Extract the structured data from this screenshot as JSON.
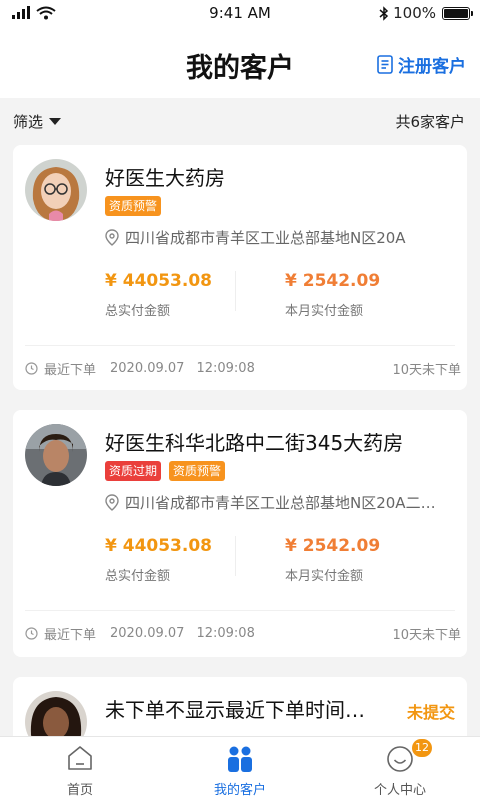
{
  "status_bar": {
    "time": "9:41 AM",
    "battery": "100%"
  },
  "header": {
    "title": "我的客户",
    "register_label": "注册客户"
  },
  "filter": {
    "label": "筛选",
    "count": "共6家客户"
  },
  "customers": [
    {
      "name": "好医生大药房",
      "tags": [
        "资质预警"
      ],
      "address": "四川省成都市青羊区工业总部基地N区20A",
      "total_amount": "¥ 44053.08",
      "total_label": "总实付金额",
      "month_amount": "¥ 2542.09",
      "month_label": "本月实付金额",
      "last_order_label": "最近下单",
      "last_order_date": "2020.09.07",
      "last_order_time": "12:09:08",
      "days": "10天未下单"
    },
    {
      "name": "好医生科华北路中二街345大药房",
      "tags": [
        "资质过期",
        "资质预警"
      ],
      "address": "四川省成都市青羊区工业总部基地N区20A二…",
      "total_amount": "¥ 44053.08",
      "total_label": "总实付金额",
      "month_amount": "¥ 2542.09",
      "month_label": "本月实付金额",
      "last_order_label": "最近下单",
      "last_order_date": "2020.09.07",
      "last_order_time": "12:09:08",
      "days": "10天未下单"
    },
    {
      "name": "未下单不显示最近下单时间…",
      "status": "未提交"
    }
  ],
  "tabbar": {
    "tabs": [
      {
        "label": "首页"
      },
      {
        "label": "我的客户"
      },
      {
        "label": "个人中心",
        "badge": "12"
      }
    ]
  },
  "colors": {
    "accent": "#1a6fe0",
    "orange": "#f29611",
    "red": "#ea3f3b"
  }
}
